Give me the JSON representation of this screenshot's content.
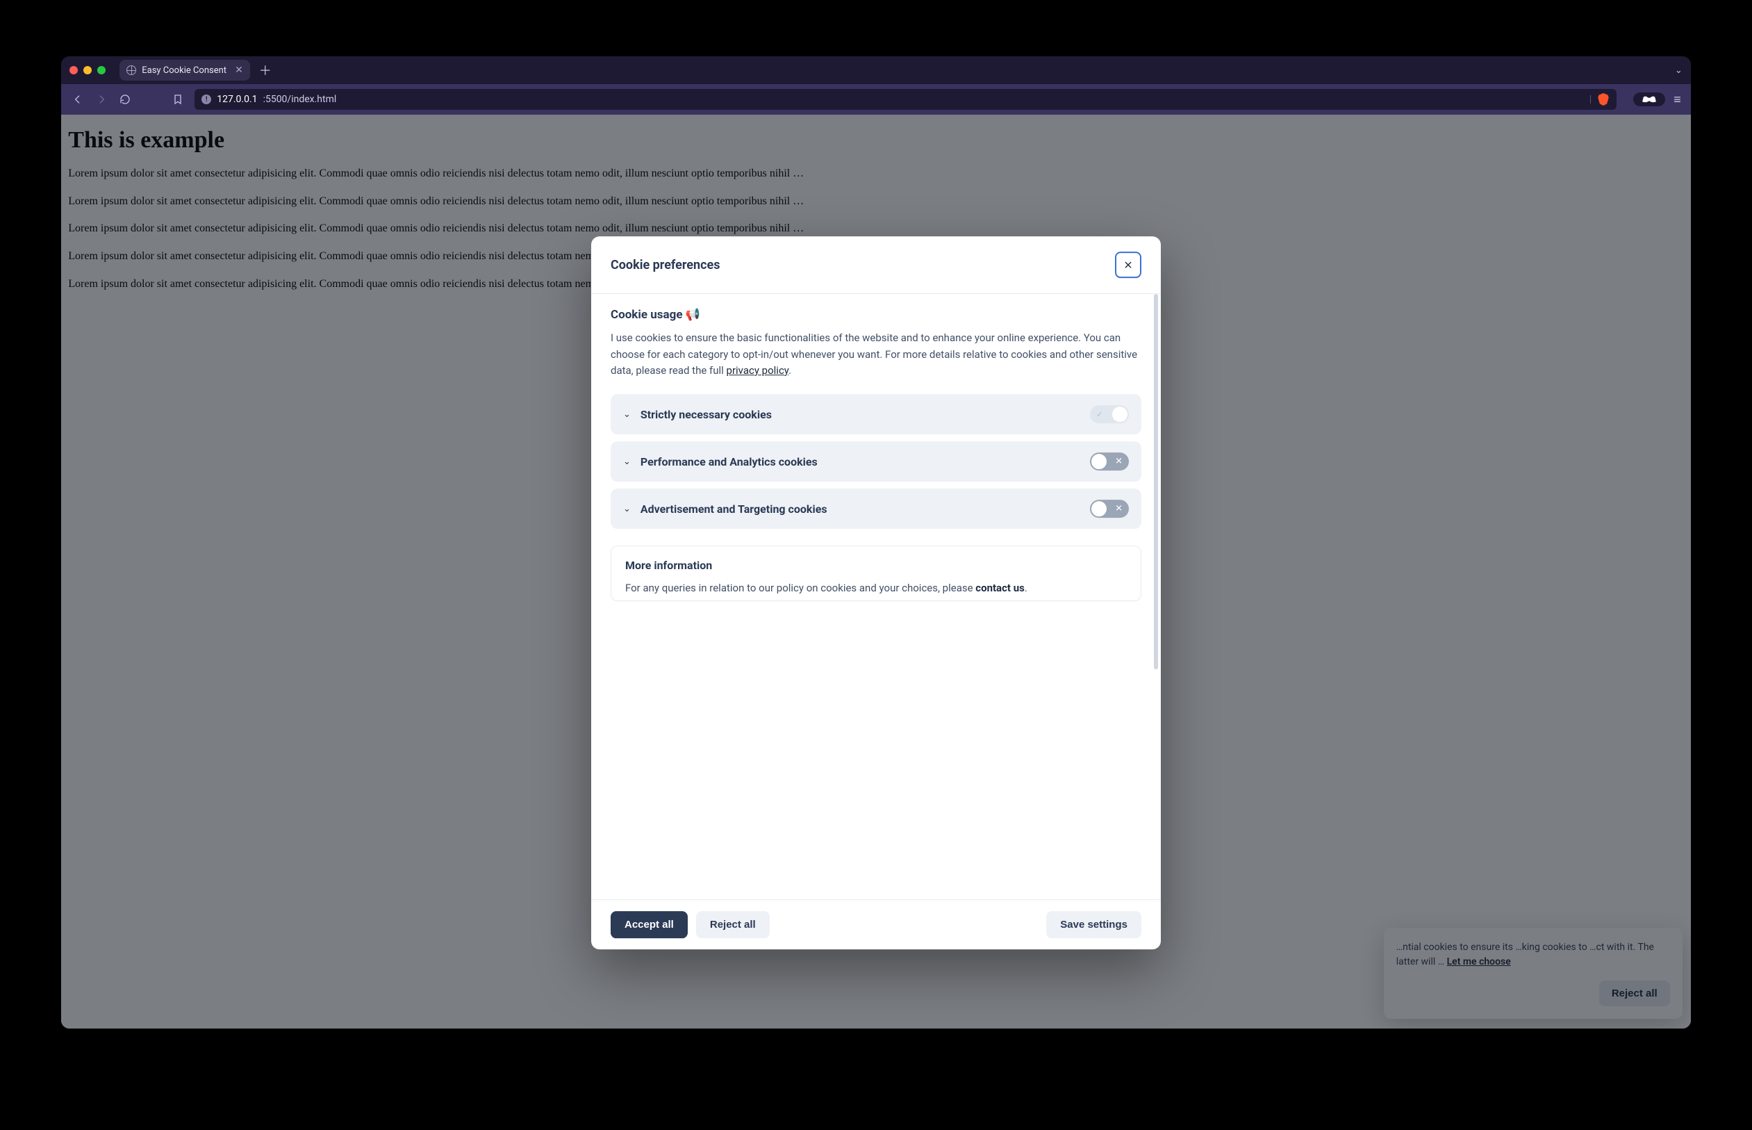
{
  "browser": {
    "tab_title": "Easy Cookie Consent",
    "url_host": "127.0.0.1",
    "url_path": ":5500/index.html"
  },
  "page": {
    "heading": "This is example",
    "para": "Lorem ipsum dolor sit amet consectetur adipisicing elit. Commodi quae omnis odio reiciendis nisi delectus totam nemo odit, illum nesciunt optio temporibus nihil …"
  },
  "banner": {
    "text_fragment": "…ntial cookies to ensure its …king cookies to …ct with it. The latter will …",
    "link": "Let me choose",
    "reject": "Reject all"
  },
  "modal": {
    "title": "Cookie preferences",
    "usage_heading": "Cookie usage 📢",
    "usage_desc": "I use cookies to ensure the basic functionalities of the website and to enhance your online experience. You can choose for each category to opt-in/out whenever you want. For more details relative to cookies and other sensitive data, please read the full ",
    "privacy_link": "privacy policy",
    "categories": [
      {
        "label": "Strictly necessary cookies",
        "state": "on-locked"
      },
      {
        "label": "Performance and Analytics cookies",
        "state": "off"
      },
      {
        "label": "Advertisement and Targeting cookies",
        "state": "off"
      }
    ],
    "moreinfo_heading": "More information",
    "moreinfo_text": "For any queries in relation to our policy on cookies and your choices, please ",
    "moreinfo_contact": "contact us",
    "accept": "Accept all",
    "reject": "Reject all",
    "save": "Save settings"
  }
}
